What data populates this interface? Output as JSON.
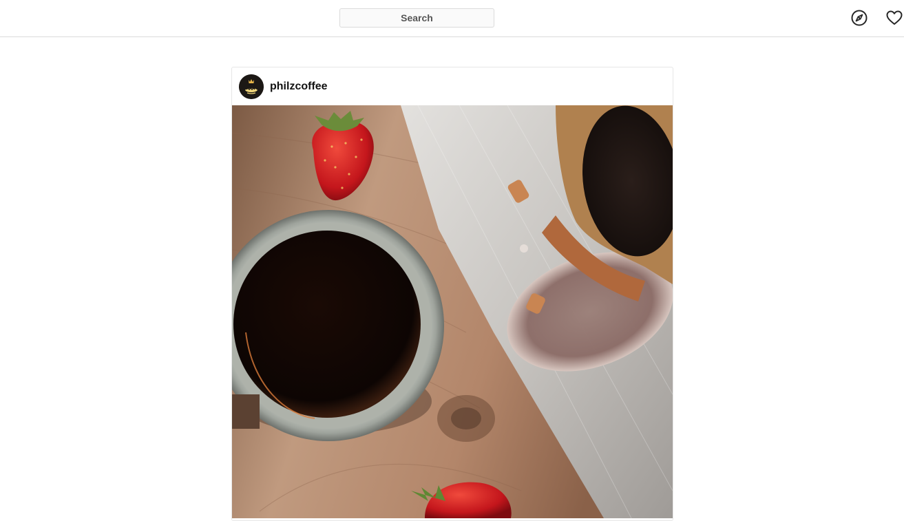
{
  "topbar": {
    "search_placeholder": "Search",
    "icons": [
      "compass-icon",
      "heart-icon"
    ]
  },
  "post": {
    "username": "philzcoffee",
    "avatar_logo_text": "Philz Coffee",
    "photo_description_icon": "coffee-photo"
  },
  "colors": {
    "border": "#dbdbdb",
    "text": "#262626",
    "wood": "#b08466",
    "cloth": "#c9c6c2"
  }
}
